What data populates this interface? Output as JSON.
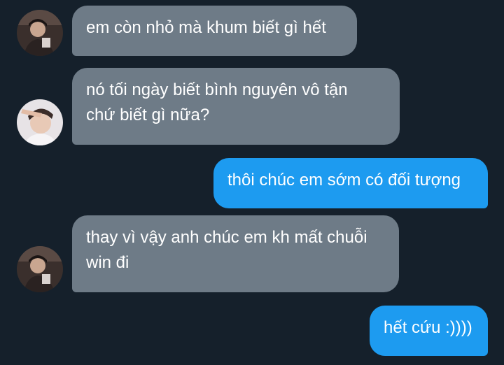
{
  "conversation": {
    "messages": [
      {
        "sender": "other",
        "avatar": "avatar-dark-portrait",
        "lines": [
          "em còn nhỏ mà khum biết gì hết"
        ]
      },
      {
        "sender": "other",
        "avatar": "avatar-saluting-person",
        "lines": [
          "nó tối ngày biết bình nguyên vô tận",
          "chứ biết gì nữa?"
        ]
      },
      {
        "sender": "me",
        "lines": [
          "thôi chúc em sớm có đối tượng"
        ]
      },
      {
        "sender": "other",
        "avatar": "avatar-dark-portrait",
        "lines": [
          "thay vì vậy anh chúc em kh mất chuỗi",
          "win đi"
        ]
      },
      {
        "sender": "me",
        "lines": [
          "hết cứu :))))"
        ]
      }
    ]
  },
  "colors": {
    "background": "#15202b",
    "incoming_bubble": "#6e7b87",
    "outgoing_bubble": "#1d9bf0",
    "text": "#ffffff"
  }
}
